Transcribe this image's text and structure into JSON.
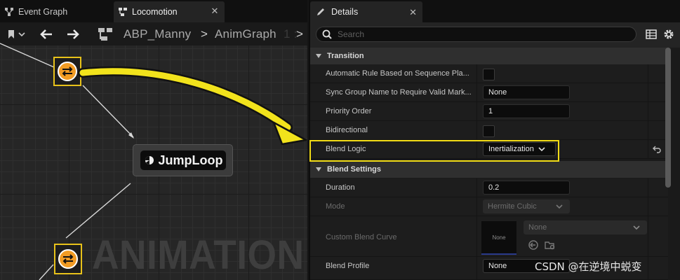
{
  "graph_tabs": [
    {
      "label": "Event Graph",
      "icon": "graph-icon"
    },
    {
      "label": "Locomotion",
      "icon": "state-machine-icon"
    }
  ],
  "breadcrumb": {
    "items": [
      "ABP_Manny",
      "AnimGraph"
    ],
    "separator": ">",
    "faded_tail": "1 :"
  },
  "graph": {
    "state_node": {
      "label": "JumpLoop",
      "icon": "state-icon"
    },
    "watermark": "ANIMATION",
    "transition_icon": "transition-rule-icon"
  },
  "details": {
    "tab_label": "Details",
    "search_placeholder": "Search",
    "sections": [
      {
        "title": "Transition",
        "rows": [
          {
            "label": "Automatic Rule Based on Sequence Pla...",
            "type": "checkbox",
            "checked": false
          },
          {
            "label": "Sync Group Name to Require Valid Mark...",
            "type": "text",
            "value": "None"
          },
          {
            "label": "Priority Order",
            "type": "text",
            "value": "1"
          },
          {
            "label": "Bidirectional",
            "type": "checkbox",
            "checked": false
          },
          {
            "label": "Blend Logic",
            "type": "dropdown",
            "value": "Inertialization",
            "highlighted": true
          }
        ]
      },
      {
        "title": "Blend Settings",
        "rows": [
          {
            "label": "Duration",
            "type": "text",
            "value": "0.2"
          },
          {
            "label": "Mode",
            "type": "dropdown",
            "value": "Hermite Cubic",
            "disabled": true
          },
          {
            "label": "Custom Blend Curve",
            "type": "curve",
            "preview": "None",
            "value": "None",
            "disabled": true
          },
          {
            "label": "Blend Profile",
            "type": "dropdown",
            "value": "None"
          }
        ]
      }
    ]
  },
  "colors": {
    "highlight": "#f2dc16",
    "arrow": "#f2e31c",
    "transition_orange": "#f29c24"
  },
  "watermark_text": "CSDN @在逆境中蜕变"
}
